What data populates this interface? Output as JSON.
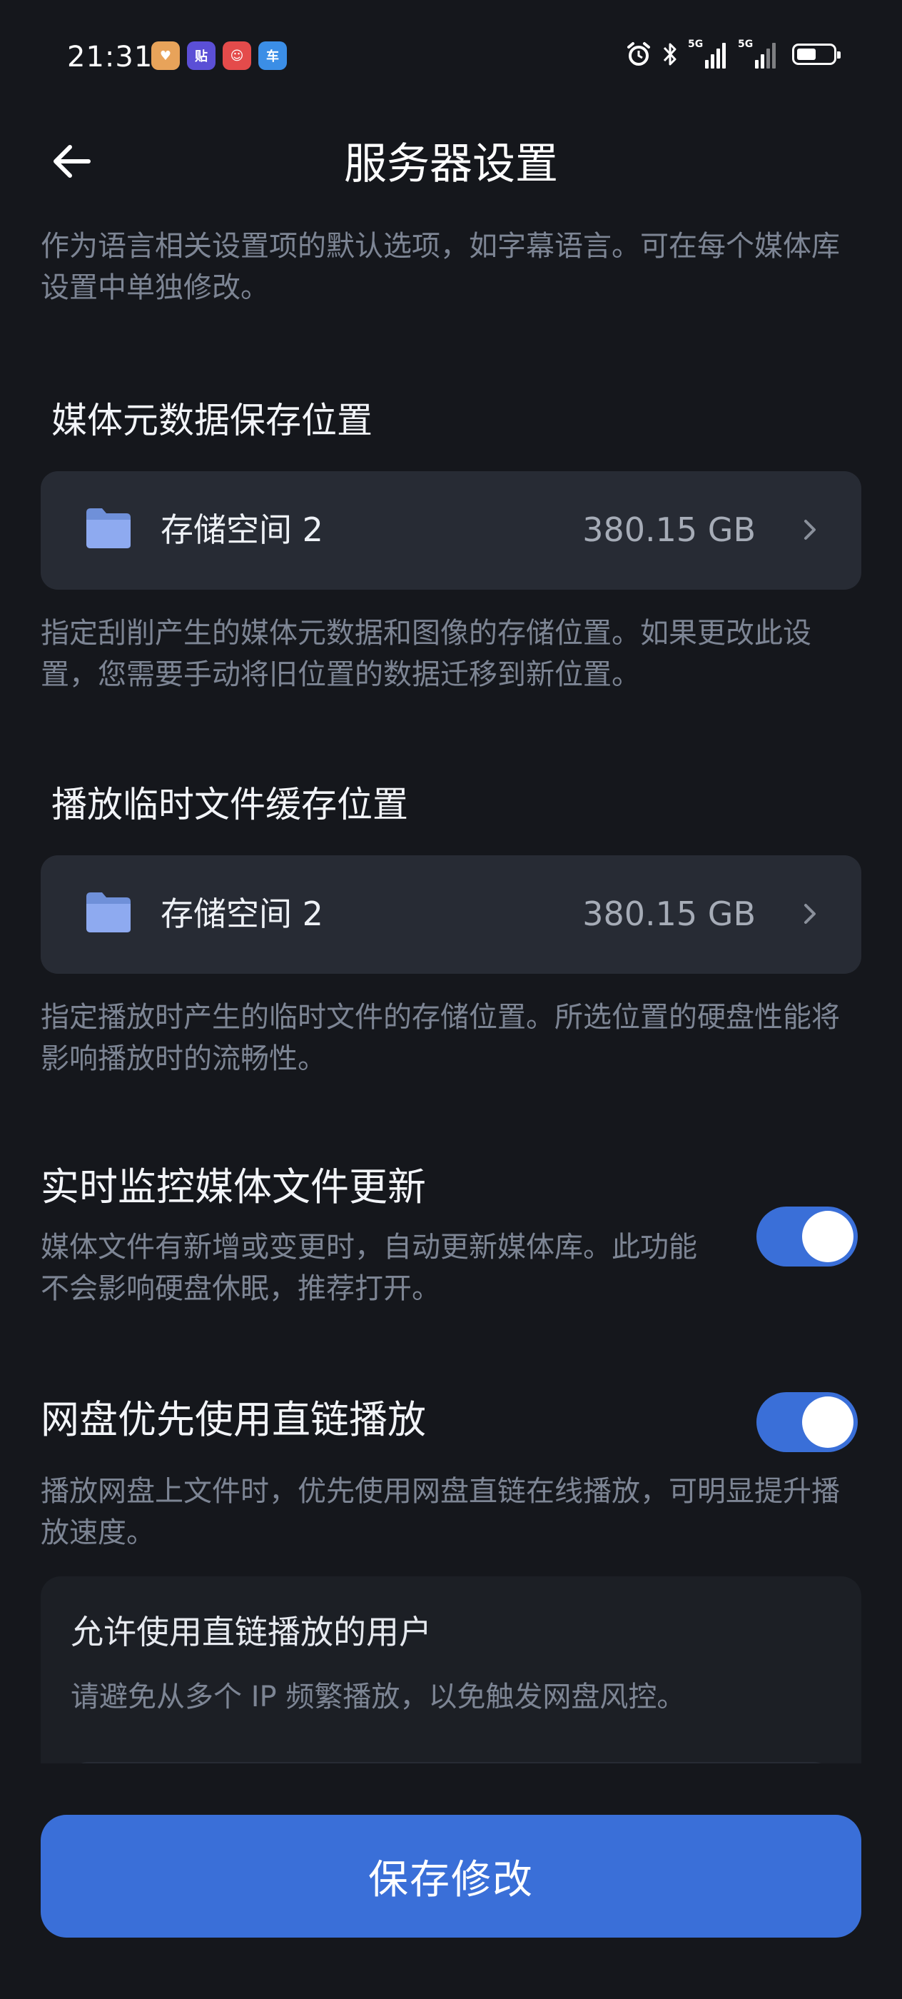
{
  "status_bar": {
    "time": "21:31",
    "apps": [
      {
        "icon": "heart-app-icon",
        "color": "#e8a35a",
        "glyph": "♥"
      },
      {
        "icon": "tieba-app-icon",
        "color": "#5b4fd6",
        "glyph": "贴"
      },
      {
        "icon": "game-app-icon",
        "color": "#e44b4b",
        "glyph": "☺"
      },
      {
        "icon": "car-app-icon",
        "color": "#3b8ee6",
        "glyph": "车"
      }
    ],
    "signal_label_1": "5G",
    "signal_label_2": "5G"
  },
  "header": {
    "title": "服务器设置"
  },
  "content": {
    "top_desc": "作为语言相关设置项的默认选项，如字幕语言。可在每个媒体库设置中单独修改。",
    "metadata": {
      "title": "媒体元数据保存位置",
      "storage_name": "存储空间 2",
      "storage_size": "380.15 GB",
      "desc": "指定刮削产生的媒体元数据和图像的存储位置。如果更改此设置，您需要手动将旧位置的数据迁移到新位置。"
    },
    "cache": {
      "title": "播放临时文件缓存位置",
      "storage_name": "存储空间 2",
      "storage_size": "380.15 GB",
      "desc": "指定播放时产生的临时文件的存储位置。所选位置的硬盘性能将影响播放时的流畅性。"
    },
    "realtime_monitor": {
      "title": "实时监控媒体文件更新",
      "desc": "媒体文件有新增或变更时，自动更新媒体库。此功能不会影响硬盘休眠，推荐打开。",
      "enabled": true
    },
    "direct_link": {
      "title": "网盘优先使用直链播放",
      "desc": "播放网盘上文件时，优先使用网盘直链在线播放，可明显提升播放速度。",
      "enabled": true
    },
    "allowed_users": {
      "title": "允许使用直链播放的用户",
      "desc": "请避免从多个 IP 频繁播放，以免触发网盘风控。"
    }
  },
  "footer": {
    "save_label": "保存修改"
  },
  "colors": {
    "background": "#15171c",
    "card": "#272b34",
    "accent": "#3a6fd8",
    "muted_text": "#7d8594"
  }
}
